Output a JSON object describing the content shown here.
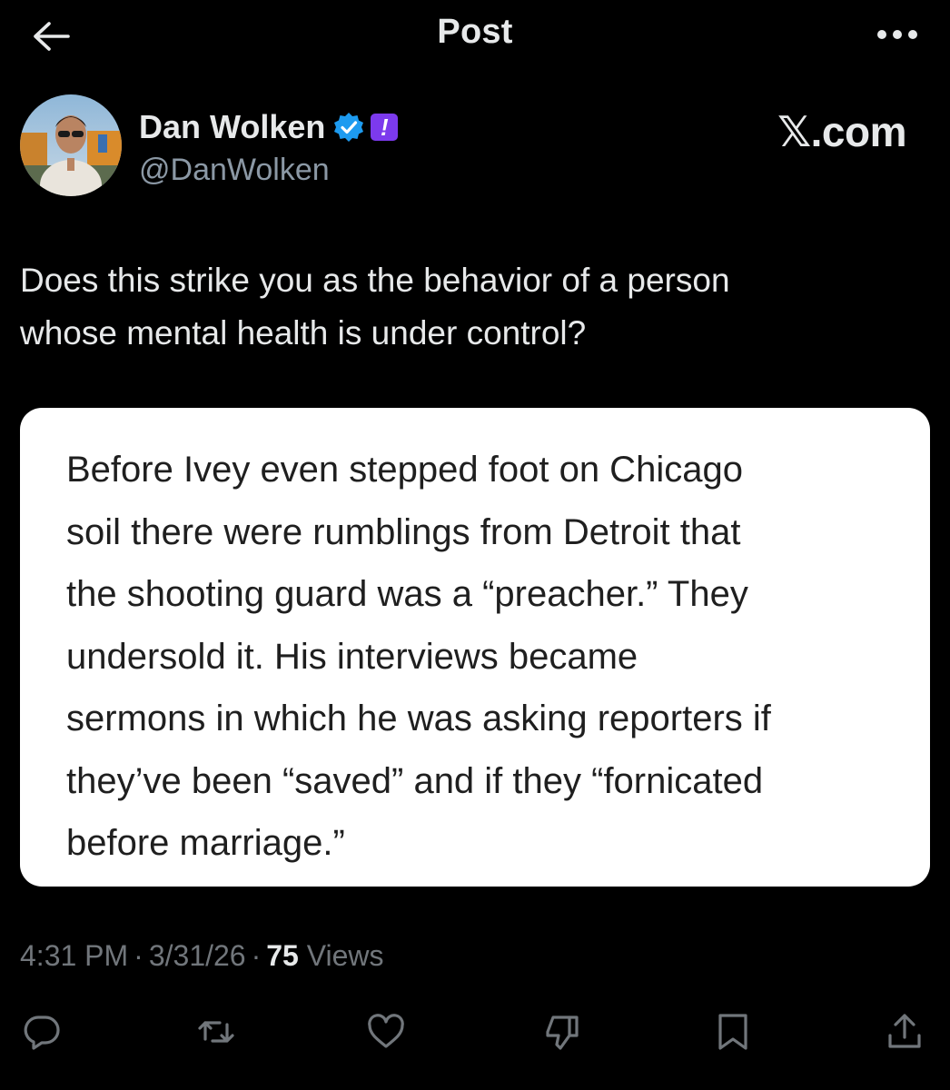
{
  "header": {
    "title": "Post",
    "back_icon": "arrow-left-icon",
    "more_icon": "ellipsis-icon"
  },
  "author": {
    "display_name": "Dan Wolken",
    "handle": "@DanWolken",
    "verified_icon": "verified-badge-icon",
    "affiliate_badge": "!",
    "source_logo": "𝕏.com"
  },
  "tweet": {
    "text_line1": "Does this strike you as the behavior of a person",
    "text_line2": "whose mental health is under control?"
  },
  "media": {
    "line1": "Before Ivey even stepped foot on Chicago",
    "line2": "soil there were rumblings from Detroit that",
    "line3": "the shooting guard was a “preacher.” They",
    "line4": "undersold it. His interviews became",
    "line5": "sermons in which he was asking reporters if",
    "line6": "they’ve been “saved” and if they “fornicated",
    "line7": "before marriage.”"
  },
  "meta": {
    "time": "4:31 PM",
    "separator": "·",
    "date": "3/31/26",
    "views_count": "75",
    "views_label": "Views"
  },
  "actions": {
    "reply_icon": "reply-icon",
    "repost_icon": "repost-icon",
    "like_icon": "heart-icon",
    "dislike_icon": "thumbs-down-icon",
    "bookmark_icon": "bookmark-icon",
    "share_icon": "share-icon"
  },
  "colors": {
    "background": "#000000",
    "text_primary": "#e7e9ea",
    "text_secondary": "#71767b",
    "verified_blue": "#1d9bf0",
    "affiliate_purple": "#7c3aed",
    "card_background": "#ffffff"
  }
}
